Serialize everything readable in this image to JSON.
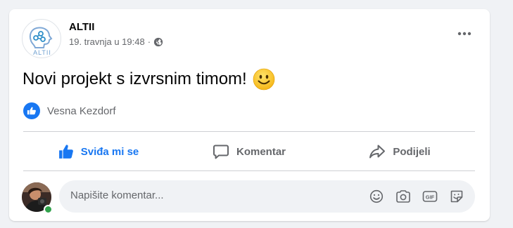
{
  "post": {
    "author": "ALTII",
    "avatar_text": "ALTII",
    "date": "19. travnja u 19:48",
    "separator": "·",
    "privacy_icon": "globe-icon",
    "text": "Novi projekt s izvrsnim timom!",
    "emoji": "slightly-smiling-face"
  },
  "reactions": {
    "icon": "like-icon",
    "names": "Vesna Kezdorf"
  },
  "actions": {
    "like_label": "Sviđa mi se",
    "comment_label": "Komentar",
    "share_label": "Podijeli"
  },
  "comment": {
    "placeholder": "Napišite komentar...",
    "tools": [
      "emoji-icon",
      "camera-icon",
      "gif-icon",
      "sticker-icon"
    ]
  },
  "colors": {
    "accent": "#1877f2",
    "secondary_text": "#65676b",
    "online": "#31a24c",
    "background": "#f0f2f5"
  }
}
